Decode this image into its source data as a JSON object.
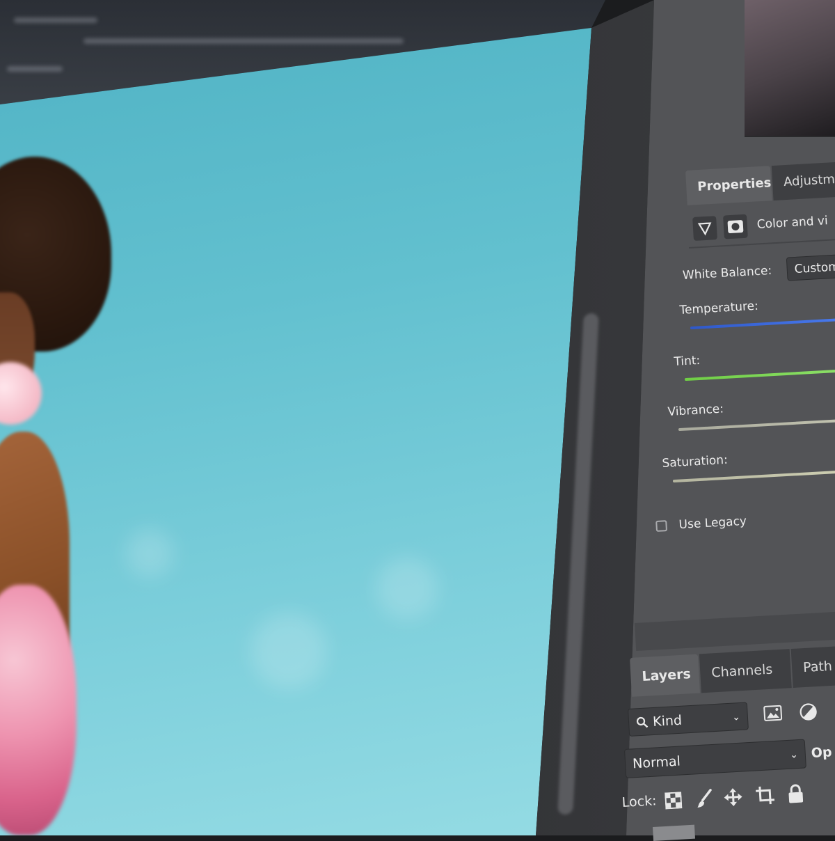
{
  "properties_panel": {
    "tabs": [
      {
        "label": "Properties",
        "active": true
      },
      {
        "label": "Adjustm",
        "active": false
      }
    ],
    "layer_title": "Color and vi",
    "white_balance": {
      "label": "White Balance:",
      "value": "Custom"
    },
    "sliders": [
      {
        "label": "Temperature:",
        "color": "#3c6bd6"
      },
      {
        "label": "Tint:",
        "color": "#7ed957"
      },
      {
        "label": "Vibrance:",
        "color": "#b8b9a8"
      },
      {
        "label": "Saturation:",
        "color": "#c9caae"
      }
    ],
    "use_legacy": {
      "label": "Use Legacy",
      "checked": false
    }
  },
  "layers_panel": {
    "tabs": [
      {
        "label": "Layers",
        "active": true
      },
      {
        "label": "Channels",
        "active": false
      },
      {
        "label": "Path",
        "active": false
      }
    ],
    "filter": {
      "label": "Kind"
    },
    "blend_mode": {
      "value": "Normal"
    },
    "opacity_label": "Op",
    "lock_label": "Lock:"
  }
}
